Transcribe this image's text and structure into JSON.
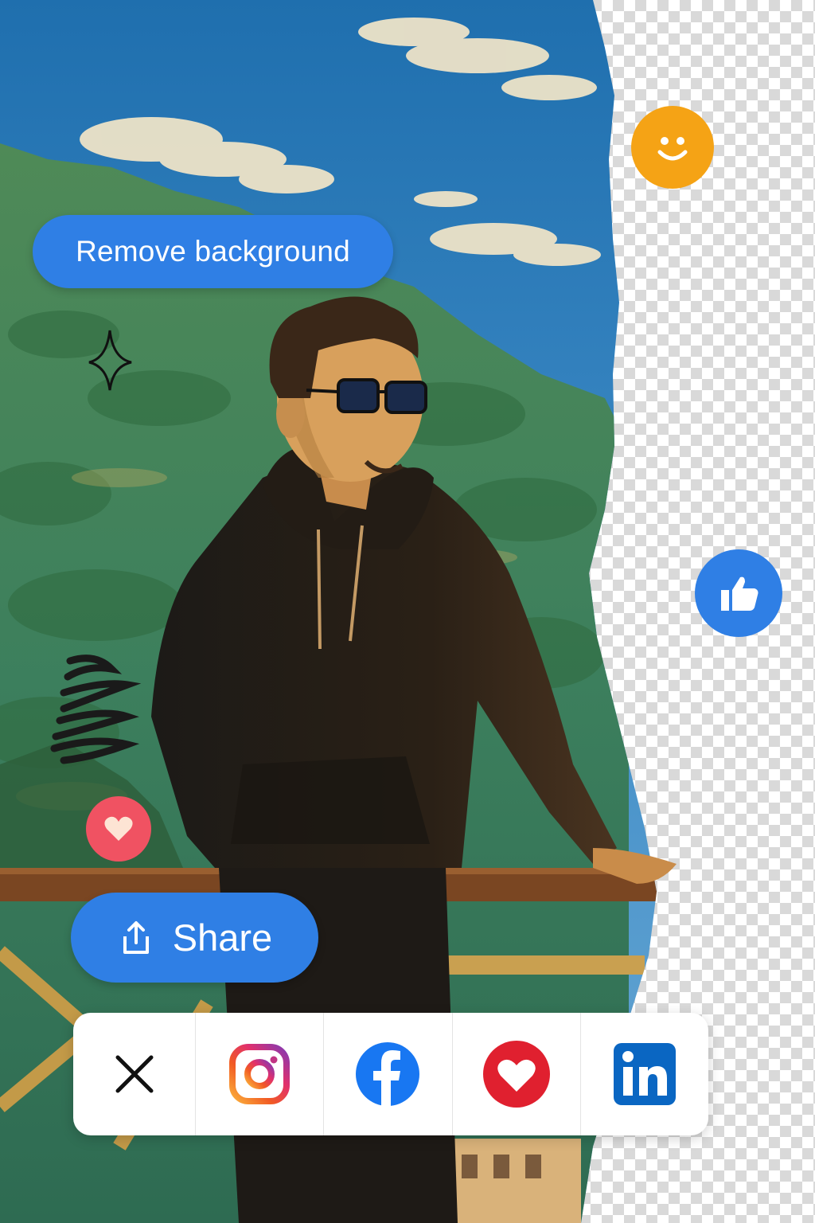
{
  "actions": {
    "remove_background_label": "Remove background",
    "share_label": "Share"
  },
  "reactions": [
    {
      "name": "smiley-icon",
      "color": "#f5a315"
    },
    {
      "name": "thumbs-up-icon",
      "color": "#2f7fe5"
    },
    {
      "name": "heart-icon",
      "color": "#f05262"
    }
  ],
  "share_targets": [
    {
      "name": "close-icon"
    },
    {
      "name": "instagram-icon"
    },
    {
      "name": "facebook-icon",
      "color": "#1877f2"
    },
    {
      "name": "heart-icon",
      "color": "#e0202f"
    },
    {
      "name": "linkedin-icon",
      "color": "#0a66c2"
    }
  ],
  "colors": {
    "accent": "#2f7fe5",
    "sky": "#2e7fbf"
  }
}
